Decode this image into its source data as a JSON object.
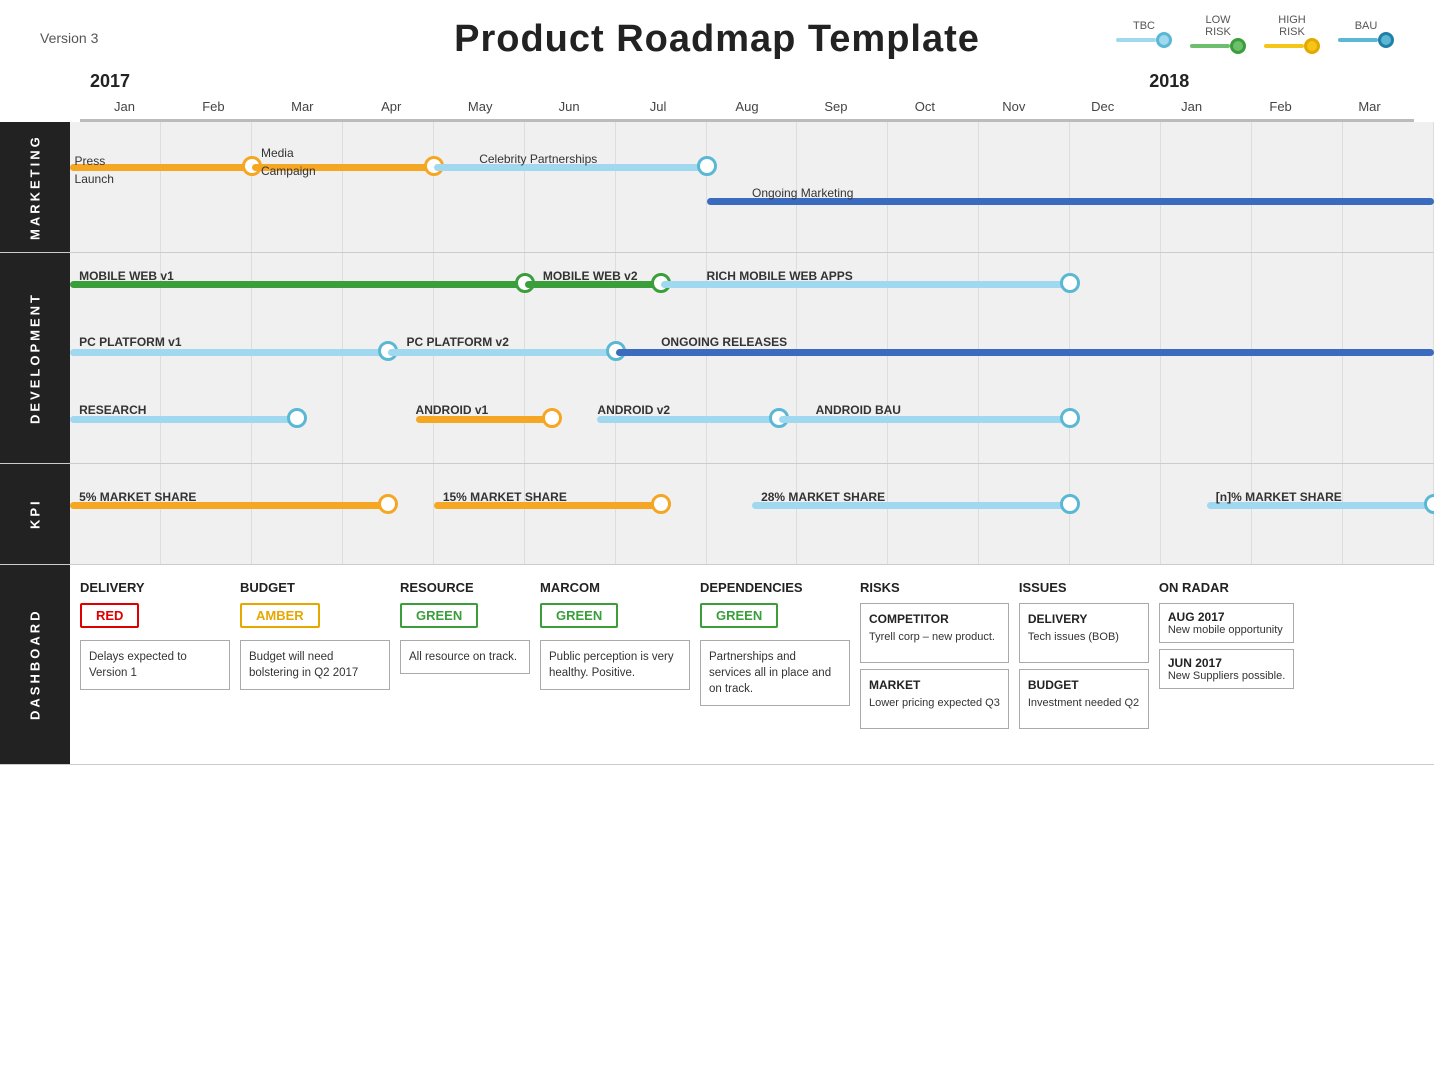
{
  "header": {
    "version": "Version 3",
    "title": "Product Roadmap Template"
  },
  "legend": {
    "items": [
      {
        "label": "TBC",
        "type": "tbc"
      },
      {
        "label": "LOW\nRISK",
        "type": "low"
      },
      {
        "label": "HIGH\nRISK",
        "type": "high"
      },
      {
        "label": "BAU",
        "type": "bau"
      }
    ]
  },
  "timeline": {
    "years": [
      {
        "label": "2017",
        "col": 1
      },
      {
        "label": "2018",
        "col": 13
      }
    ],
    "months": [
      "Jan",
      "Feb",
      "Mar",
      "Apr",
      "May",
      "Jun",
      "Jul",
      "Aug",
      "Sep",
      "Oct",
      "Nov",
      "Dec",
      "Jan",
      "Feb",
      "Mar"
    ]
  },
  "sections": {
    "marketing": {
      "label": "MARKETING",
      "tracks": [
        {
          "label": "Press\nLaunch",
          "type": "orange",
          "startCol": 1,
          "endCol": 2,
          "milestoneCol": 2
        },
        {
          "label": "Media\nCampaign",
          "type": "orange",
          "startCol": 2,
          "endCol": 4,
          "milestoneCol": 4
        },
        {
          "label": "Celebrity Partnerships",
          "type": "blue",
          "startCol": 4,
          "endCol": 7,
          "milestoneCol": 7
        },
        {
          "label": "Ongoing Marketing",
          "type": "darkblue",
          "startCol": 7,
          "endCol": 15,
          "milestoneCol": null
        }
      ]
    },
    "development": {
      "label": "DEVELOPMENT",
      "rows": [
        {
          "label": "MOBILE WEB v1",
          "type": "green",
          "startCol": 1,
          "endCol": 5,
          "milestoneCol": 5,
          "nextLabel": "MOBILE WEB v2",
          "nextStart": 5,
          "nextEnd": 6,
          "nextMilestone": 6,
          "thirdLabel": "RICH MOBILE WEB APPS",
          "thirdStart": 6,
          "thirdEnd": 11,
          "thirdMilestone": 11
        },
        {
          "label": "PC PLATFORM v1",
          "type": "blue",
          "startCol": 1,
          "endCol": 4,
          "milestoneCol": 4,
          "nextLabel": "PC PLATFORM v2",
          "nextStart": 4,
          "nextEnd": 6,
          "nextMilestone": 6,
          "thirdLabel": "ONGOING RELEASES",
          "thirdStart": 6,
          "thirdEnd": 15,
          "thirdMilestone": null
        },
        {
          "label": "RESEARCH",
          "type": "blue",
          "startCol": 1,
          "endCol": 3,
          "milestoneCol": 3,
          "nextLabel": "ANDROID v1",
          "nextStart": 4,
          "nextEnd": 6,
          "nextMilestone": 5,
          "thirdLabel": "ANDROID v2",
          "thirdStart": 6,
          "thirdEnd": 8,
          "thirdMilestone": 8,
          "fourthLabel": "ANDROID BAU",
          "fourthStart": 8,
          "fourthEnd": 11,
          "fourthMilestone": 11
        }
      ]
    },
    "kpi": {
      "label": "KPI",
      "items": [
        {
          "label": "5% MARKET SHARE",
          "startCol": 1,
          "endCol": 4,
          "milestoneCol": 4
        },
        {
          "label": "15% MARKET SHARE",
          "startCol": 4,
          "endCol": 6,
          "milestoneCol": 6
        },
        {
          "label": "28% MARKET SHARE",
          "startCol": 8,
          "endCol": 11,
          "milestoneCol": 11
        },
        {
          "label": "[n]% MARKET SHARE",
          "startCol": 13,
          "endCol": 15,
          "milestoneCol": 15
        }
      ]
    },
    "dashboard": {
      "label": "DASHBOARD",
      "cols": [
        {
          "title": "DELIVERY",
          "badge": "RED",
          "badgeType": "red",
          "text": "Delays expected to Version 1"
        },
        {
          "title": "BUDGET",
          "badge": "AMBER",
          "badgeType": "amber",
          "text": "Budget will need bolstering in Q2 2017"
        },
        {
          "title": "RESOURCE",
          "badge": "GREEN",
          "badgeType": "green",
          "text": "All resource on track."
        },
        {
          "title": "MARCOM",
          "badge": "GREEN",
          "badgeType": "green",
          "text": "Public perception is very healthy. Positive."
        },
        {
          "title": "DEPENDENCIES",
          "badge": "GREEN",
          "badgeType": "green",
          "text": "Partnerships and services all in place and on track."
        },
        {
          "title": "RISKS",
          "boxes": [
            {
              "title": "COMPETITOR",
              "text": "Tyrell corp – new product."
            },
            {
              "title": "MARKET",
              "text": "Lower pricing expected Q3"
            }
          ]
        },
        {
          "title": "ISSUES",
          "boxes": [
            {
              "title": "DELIVERY",
              "text": "Tech issues (BOB)"
            },
            {
              "title": "BUDGET",
              "text": "Investment needed Q2"
            }
          ]
        },
        {
          "title": "ON RADAR",
          "items": [
            {
              "date": "AUG 2017",
              "text": "New mobile opportunity"
            },
            {
              "date": "JUN 2017",
              "text": "New Suppliers possible."
            }
          ]
        }
      ]
    }
  }
}
